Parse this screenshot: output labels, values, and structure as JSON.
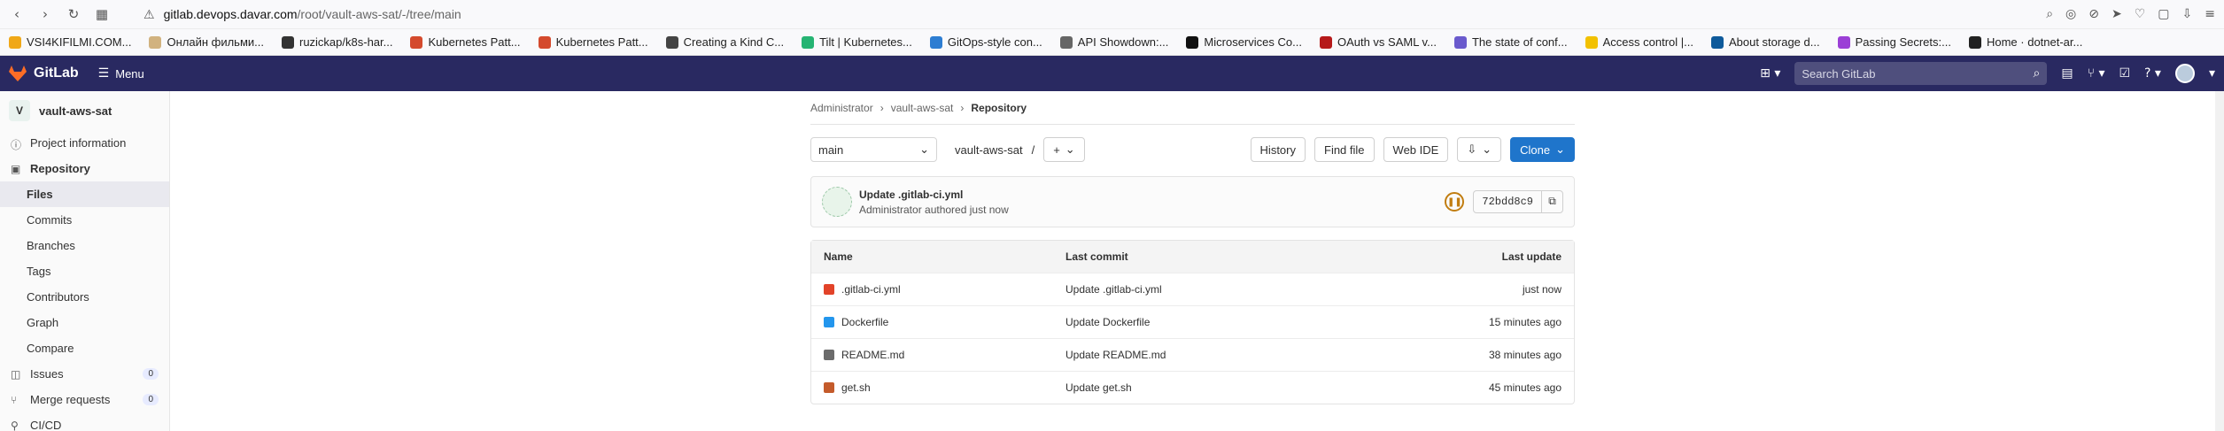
{
  "browser": {
    "url_host": "gitlab.devops.davar.com",
    "url_path": "/root/vault-aws-sat/-/tree/main",
    "bookmarks": [
      {
        "label": "VSI4KIFILMI.COM...",
        "color": "#f0a818"
      },
      {
        "label": "Онлайн фильми...",
        "color": "#d1b27f"
      },
      {
        "label": "ruzickap/k8s-har...",
        "color": "#333333"
      },
      {
        "label": "Kubernetes Patt...",
        "color": "#d44a2d"
      },
      {
        "label": "Kubernetes Patt...",
        "color": "#d44a2d"
      },
      {
        "label": "Creating a Kind C...",
        "color": "#444444"
      },
      {
        "label": "Tilt | Kubernetes...",
        "color": "#26b473"
      },
      {
        "label": "GitOps-style con...",
        "color": "#2d7dd2"
      },
      {
        "label": "API Showdown:...",
        "color": "#666666"
      },
      {
        "label": "Microservices Co...",
        "color": "#111111"
      },
      {
        "label": "OAuth vs SAML v...",
        "color": "#b61a1a"
      },
      {
        "label": "The state of conf...",
        "color": "#6a5acd"
      },
      {
        "label": "Access control |...",
        "color": "#f2c100"
      },
      {
        "label": "About storage d...",
        "color": "#0e5a9b"
      },
      {
        "label": "Passing Secrets:...",
        "color": "#9b3fd6"
      },
      {
        "label": "Home · dotnet-ar...",
        "color": "#222222"
      }
    ]
  },
  "header": {
    "logo": "GitLab",
    "menu": "Menu",
    "search_placeholder": "Search GitLab"
  },
  "sidebar": {
    "project_initial": "V",
    "project_name": "vault-aws-sat",
    "items": [
      {
        "label": "Project information",
        "icon": "info-icon"
      },
      {
        "label": "Repository",
        "icon": "repo-icon"
      }
    ],
    "repo_sub": [
      "Files",
      "Commits",
      "Branches",
      "Tags",
      "Contributors",
      "Graph",
      "Compare"
    ],
    "issues": {
      "label": "Issues",
      "count": "0"
    },
    "merge_requests": {
      "label": "Merge requests",
      "count": "0"
    },
    "cicd": "CI/CD"
  },
  "breadcrumb": [
    "Administrator",
    "vault-aws-sat",
    "Repository"
  ],
  "toolbar": {
    "branch": "main",
    "path": "vault-aws-sat",
    "separator": "/",
    "plus": "+",
    "history": "History",
    "find_file": "Find file",
    "web_ide": "Web IDE",
    "clone": "Clone"
  },
  "commit": {
    "title": "Update .gitlab-ci.yml",
    "author": "Administrator",
    "action": "authored just now",
    "sha": "72bdd8c9"
  },
  "table": {
    "headers": [
      "Name",
      "Last commit",
      "Last update"
    ],
    "rows": [
      {
        "name": ".gitlab-ci.yml",
        "commit": "Update .gitlab-ci.yml",
        "updated": "just now",
        "icon": "#e24329"
      },
      {
        "name": "Dockerfile",
        "commit": "Update Dockerfile",
        "updated": "15 minutes ago",
        "icon": "#2396ed"
      },
      {
        "name": "README.md",
        "commit": "Update README.md",
        "updated": "38 minutes ago",
        "icon": "#6b6b6b"
      },
      {
        "name": "get.sh",
        "commit": "Update get.sh",
        "updated": "45 minutes ago",
        "icon": "#c45b2b"
      }
    ]
  }
}
